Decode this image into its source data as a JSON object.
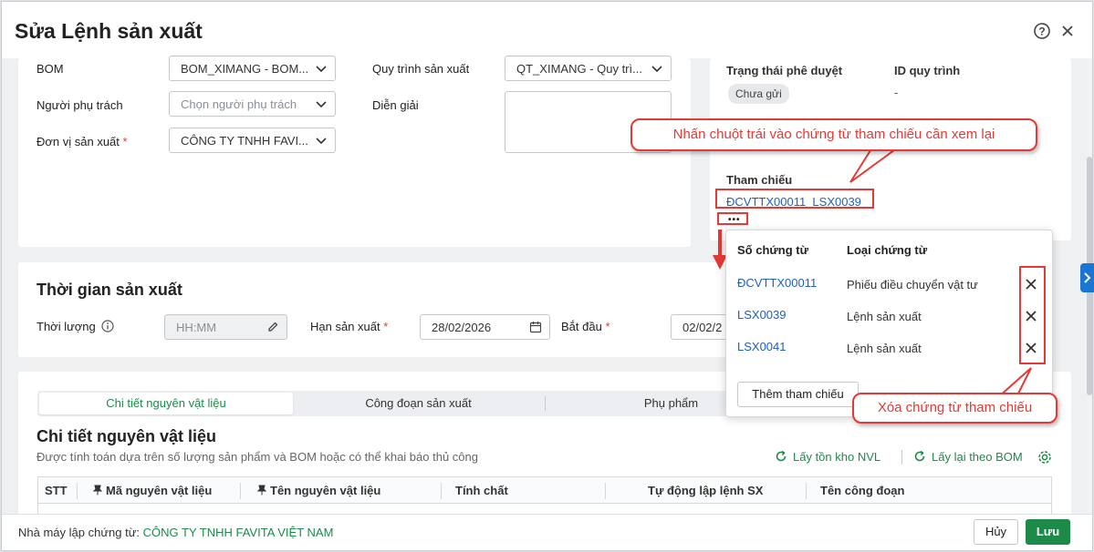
{
  "dialog": {
    "title": "Sửa Lệnh sản xuất"
  },
  "general": {
    "bom_label": "BOM",
    "bom_value": "BOM_XIMANG - BOM...",
    "process_label": "Quy trình sản xuất",
    "process_value": "QT_XIMANG - Quy trì...",
    "owner_label": "Người phụ trách",
    "owner_placeholder": "Chọn người phụ trách",
    "desc_label": "Diễn giải",
    "unit_label": "Đơn vị sản xuất",
    "unit_required": "*",
    "unit_value": "CÔNG TY TNHH FAVI..."
  },
  "side": {
    "approval_label": "Trạng thái phê duyệt",
    "approval_value": "Chưa gửi",
    "process_id_label": "ID quy trình",
    "process_id_value": "-",
    "ref_label": "Tham chiếu",
    "ref_links": [
      "ĐCVTTX00011",
      "LSX0039"
    ],
    "more_label": "•••"
  },
  "callouts": {
    "top": "Nhấn chuột trái vào chứng từ tham chiếu cần xem lại",
    "bottom": "Xóa chứng từ tham chiếu"
  },
  "popover": {
    "col_number": "Số chứng từ",
    "col_type": "Loại chứng từ",
    "rows": [
      {
        "number": "ĐCVTTX00011",
        "type": "Phiếu điều chuyển vật tư"
      },
      {
        "number": "LSX0039",
        "type": "Lệnh sản xuất"
      },
      {
        "number": "LSX0041",
        "type": "Lệnh sản xuất"
      }
    ],
    "add_button": "Thêm tham chiếu"
  },
  "time": {
    "section_title": "Thời gian sản xuất",
    "duration_label": "Thời lượng",
    "duration_placeholder": "HH:MM",
    "deadline_label": "Hạn sản xuất",
    "required": "*",
    "deadline_value": "28/02/2026",
    "start_label": "Bắt đầu",
    "start_value": "02/02/2"
  },
  "tabs": [
    "Chi tiết nguyên vật liệu",
    "Công đoạn sản xuất",
    "Phụ phẩm"
  ],
  "materials": {
    "title": "Chi tiết nguyên vật liệu",
    "subtitle": "Được tính toán dựa trên số lượng sản phẩm và BOM hoặc có thể khai báo thủ công",
    "action_stock": "Lấy tồn kho NVL",
    "action_bom": "Lấy lại theo BOM",
    "columns": [
      "STT",
      "Mã nguyên vật liệu",
      "Tên nguyên vật liệu",
      "Tính chất",
      "Tự động lập lệnh SX",
      "Tên công đoạn"
    ]
  },
  "footer": {
    "factory_label": "Nhà máy lập chứng từ:",
    "factory_value": "CÔNG TY TNHH FAVITA VIỆT NAM",
    "cancel": "Hủy",
    "save": "Lưu"
  },
  "colors": {
    "accent_green": "#1e8a4a",
    "link_blue": "#1f5fbf",
    "annotation_red": "#e53935"
  }
}
